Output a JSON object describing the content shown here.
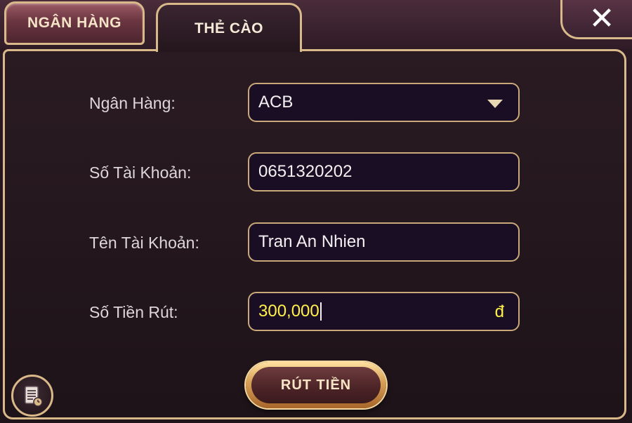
{
  "tabs": {
    "bank_label": "NGÂN HÀNG",
    "card_label": "THẺ CÀO"
  },
  "close_label": "✕",
  "form": {
    "bank": {
      "label": "Ngân Hàng:",
      "value": "ACB"
    },
    "account_number": {
      "label": "Số Tài Khoản:",
      "value": "0651320202"
    },
    "account_name": {
      "label": "Tên Tài Khoản:",
      "value": "Tran An Nhien"
    },
    "amount": {
      "label": "Số Tiền Rút:",
      "value": "300,000",
      "currency": "đ"
    }
  },
  "withdraw_button": "RÚT TIỀN",
  "icons": {
    "close": "close-icon",
    "dropdown": "chevron-down-icon",
    "history": "history-icon"
  },
  "colors": {
    "gold_border": "#d9b98a",
    "amount_text": "#fff04a",
    "field_bg": "#1a0e24"
  }
}
